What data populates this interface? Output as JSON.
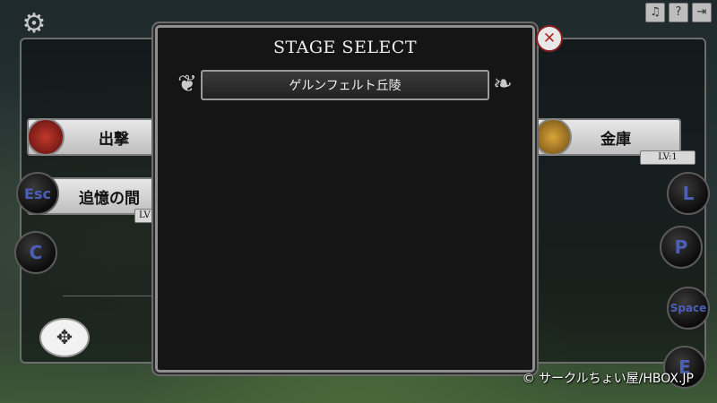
{
  "settings_icon": "gear-icon",
  "top_icons": [
    {
      "name": "music-icon",
      "glyph": "♫"
    },
    {
      "name": "help-icon",
      "glyph": "?"
    },
    {
      "name": "exit-icon",
      "glyph": "⇥"
    }
  ],
  "menu": {
    "sortie": {
      "label": "出撃",
      "icon": "sortie-icon"
    },
    "memory": {
      "label": "追憶の間",
      "level_tag": "LV"
    },
    "vault": {
      "label": "金庫",
      "icon": "coin-icon",
      "level": "LV:1"
    }
  },
  "virtual_buttons": {
    "esc": "Esc",
    "c": "C",
    "l": "L",
    "p": "P",
    "space": "Space",
    "e": "E"
  },
  "dialog": {
    "title": "STAGE SELECT",
    "stages": [
      "ゲルンフェルト丘陵"
    ],
    "close_icon": "close-icon"
  },
  "copyright": "© サークルちょい屋/HBOX.JP",
  "colors": {
    "accent_button_text": "#4c5fb8",
    "close_icon": "#b22222",
    "dialog_bg": "#151515"
  }
}
